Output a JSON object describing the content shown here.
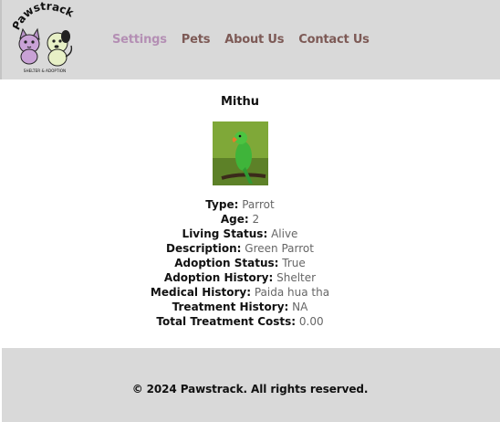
{
  "brand": {
    "logo_text": "Pawstrack",
    "logo_subtext": "SHELTER & ADOPTION"
  },
  "nav": {
    "items": [
      {
        "label": "Settings",
        "active": true
      },
      {
        "label": "Pets",
        "active": false
      },
      {
        "label": "About Us",
        "active": false
      },
      {
        "label": "Contact Us",
        "active": false
      }
    ]
  },
  "pet": {
    "name": "Mithu",
    "details": [
      {
        "label": "Type:",
        "value": "Parrot"
      },
      {
        "label": "Age:",
        "value": "2"
      },
      {
        "label": "Living Status:",
        "value": "Alive"
      },
      {
        "label": "Description:",
        "value": "Green Parrot"
      },
      {
        "label": "Adoption Status:",
        "value": "True"
      },
      {
        "label": "Adoption History:",
        "value": "Shelter"
      },
      {
        "label": "Medical History:",
        "value": "Paida hua tha"
      },
      {
        "label": "Treatment History:",
        "value": "NA"
      },
      {
        "label": "Total Treatment Costs:",
        "value": "0.00"
      }
    ]
  },
  "footer": {
    "copyright": "© 2024 Pawstrack. All rights reserved."
  },
  "colors": {
    "header_bg": "#d9d9d9",
    "nav_text": "#7d5a56",
    "nav_active": "#b48fb4",
    "footer_bg": "#d9d9d9"
  }
}
